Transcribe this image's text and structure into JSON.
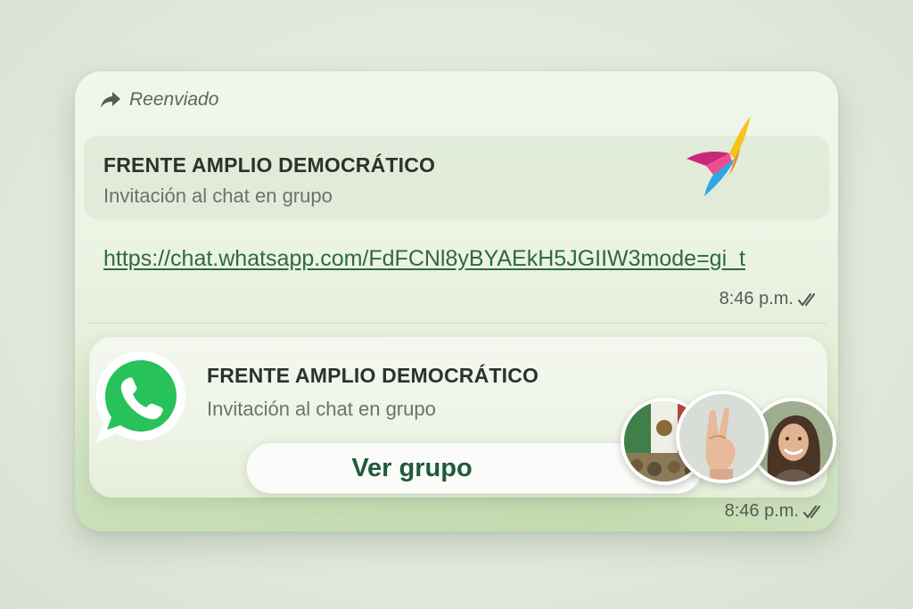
{
  "message": {
    "forwarded_label": "Reenviado",
    "link_preview": {
      "title": "FRENTE AMPLIO DEMOCRÁTICO",
      "subtitle": "Invitación al chat en grupo"
    },
    "link_url": "https://chat.whatsapp.com/FdFCNl8yBYAEkH5JGIIW3mode=gi_t",
    "time_1": "8:46 p.m.",
    "group_invite": {
      "title": "FRENTE AMPLIO DEMOCRÁTICO",
      "subtitle": "Invitación al chat en grupo",
      "button_label": "Ver grupo"
    },
    "time_2": "8:46 p.m."
  },
  "icons": {
    "forward": "forward-arrow-icon",
    "brand_logo": "frente-amplio-logo",
    "whatsapp": "whatsapp-logo",
    "read_receipt": "double-check-icon"
  },
  "colors": {
    "link": "#2e6a3e",
    "button_text": "#1f5a3b",
    "whatsapp_green": "#25d366",
    "bubble_bg": "#ebf3e3"
  }
}
